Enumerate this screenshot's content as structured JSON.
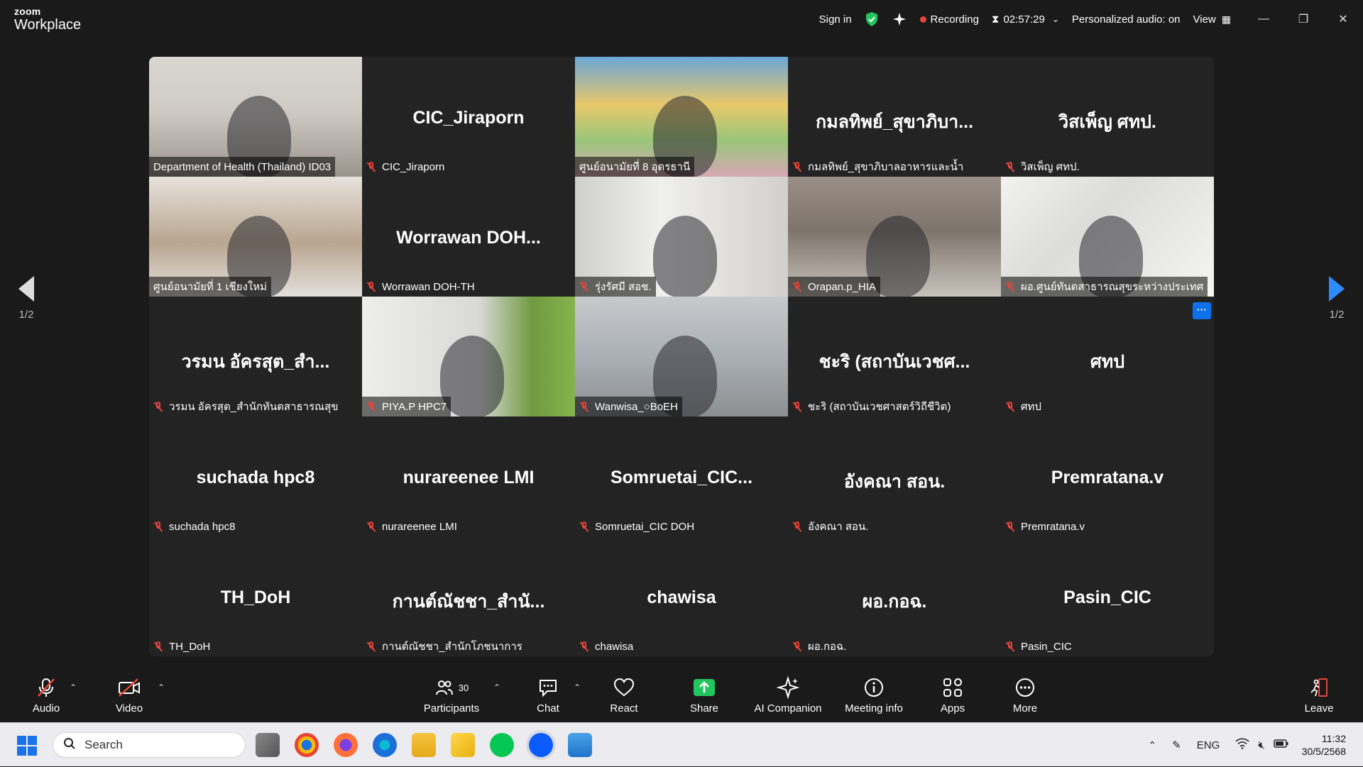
{
  "window": {
    "brand_top": "zoom",
    "brand_bottom": "Workplace",
    "sign_in": "Sign in",
    "recording": "Recording",
    "timer": "02:57:29",
    "audio_status": "Personalized audio: on",
    "view": "View"
  },
  "pager": {
    "left": "1/2",
    "right": "1/2"
  },
  "tiles": [
    {
      "display": "",
      "label": "Department of Health (Thailand) ID03",
      "video": true,
      "scene": "s-room",
      "active": true
    },
    {
      "display": "CIC_Jiraporn",
      "label": "CIC_Jiraporn",
      "video": false
    },
    {
      "display": "",
      "label": "ศูนย์อนามัยที่ 8 อุดรธานี",
      "video": true,
      "scene": "s-poster"
    },
    {
      "display": "กมลทิพย์_สุขาภิบา...",
      "label": "กมลทิพย์_สุขาภิบาลอาหารและน้ำ",
      "video": false
    },
    {
      "display": "วิสเพ็ญ ศทป.",
      "label": "วิสเพ็ญ ศทป.",
      "video": false
    },
    {
      "display": "",
      "label": "ศูนย์อนามัยที่ 1 เชียงใหม่",
      "video": true,
      "scene": "s-office1"
    },
    {
      "display": "Worrawan  DOH...",
      "label": "Worrawan DOH-TH",
      "video": false
    },
    {
      "display": "",
      "label": "รุ่งรัศมี สอช.",
      "video": true,
      "scene": "s-blur"
    },
    {
      "display": "",
      "label": "Orapan.p_HIA",
      "video": true,
      "scene": "s-office2"
    },
    {
      "display": "",
      "label": "ผอ.ศูนย์ทันตสาธารณสุขระหว่างประเทศ",
      "video": true,
      "scene": "s-marble"
    },
    {
      "display": "วรมน อัครสุต_สำ...",
      "label": "วรมน อัครสุต_สำนักทันตสาธารณสุข",
      "video": false
    },
    {
      "display": "",
      "label": "PIYA.P HPC7",
      "video": true,
      "scene": "s-desk"
    },
    {
      "display": "",
      "label": "Wanwisa_○BoEH",
      "video": true,
      "scene": "s-openoffice"
    },
    {
      "display": "ชะริ (สถาบันเวชศ...",
      "label": "ชะริ (สถาบันเวชศาสตร์วิถีชีวิต)",
      "video": false
    },
    {
      "display": "ศทป",
      "label": "ศทป",
      "video": false
    },
    {
      "display": "suchada hpc8",
      "label": "suchada hpc8",
      "video": false
    },
    {
      "display": "nurareenee LMI",
      "label": "nurareenee LMI",
      "video": false
    },
    {
      "display": "Somruetai_CIC...",
      "label": "Somruetai_CIC DOH",
      "video": false
    },
    {
      "display": "อังคณา สอน.",
      "label": "อังคณา สอน.",
      "video": false
    },
    {
      "display": "Premratana.v",
      "label": "Premratana.v",
      "video": false
    },
    {
      "display": "TH_DoH",
      "label": "TH_DoH",
      "video": false
    },
    {
      "display": "กานต์ณัชชา_สำนั...",
      "label": "กานต์ณัชชา_สำนักโภชนาการ",
      "video": false
    },
    {
      "display": "chawisa",
      "label": "chawisa",
      "video": false
    },
    {
      "display": "ผอ.กอฉ.",
      "label": "ผอ.กอฉ.",
      "video": false
    },
    {
      "display": "Pasin_CIC",
      "label": "Pasin_CIC",
      "video": false
    }
  ],
  "toolbar": {
    "audio": "Audio",
    "video": "Video",
    "participants": "Participants",
    "participants_count": "30",
    "chat": "Chat",
    "react": "React",
    "share": "Share",
    "ai": "AI Companion",
    "info": "Meeting info",
    "apps": "Apps",
    "more": "More",
    "leave": "Leave"
  },
  "taskbar": {
    "search_placeholder": "Search",
    "lang": "ENG",
    "time": "11:32",
    "date": "30/5/2568"
  }
}
